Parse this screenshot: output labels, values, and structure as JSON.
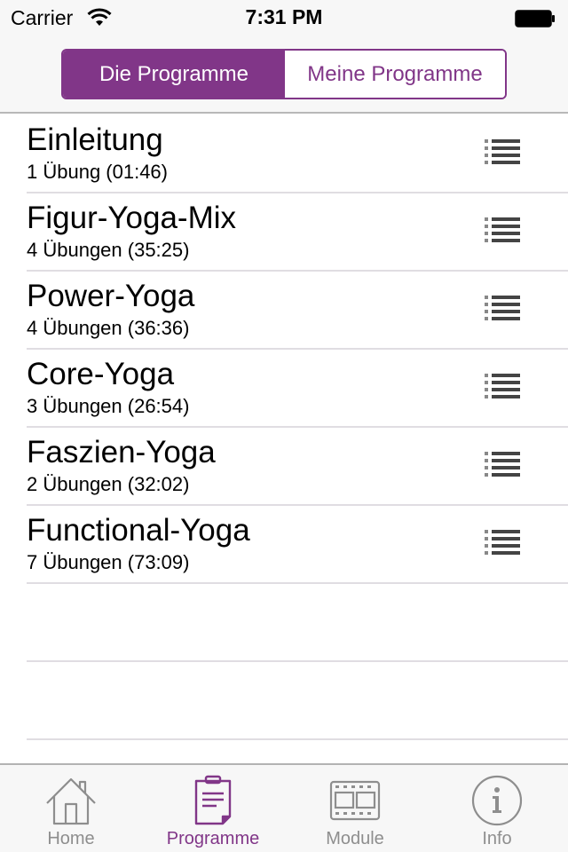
{
  "status_bar": {
    "carrier": "Carrier",
    "time": "7:31 PM",
    "wifi_icon": "wifi-icon",
    "battery_icon": "battery-full-icon"
  },
  "segmented_control": {
    "selected_index": 0,
    "segments": [
      {
        "label": "Die Programme"
      },
      {
        "label": "Meine Programme"
      }
    ]
  },
  "programs": [
    {
      "title": "Einleitung",
      "subtitle": "1 Übung (01:46)",
      "icon": "list-icon"
    },
    {
      "title": "Figur-Yoga-Mix",
      "subtitle": "4 Übungen (35:25)",
      "icon": "list-icon"
    },
    {
      "title": "Power-Yoga",
      "subtitle": "4 Übungen (36:36)",
      "icon": "list-icon"
    },
    {
      "title": "Core-Yoga",
      "subtitle": "3 Übungen (26:54)",
      "icon": "list-icon"
    },
    {
      "title": "Faszien-Yoga",
      "subtitle": "2 Übungen (32:02)",
      "icon": "list-icon"
    },
    {
      "title": "Functional-Yoga",
      "subtitle": "7 Übungen (73:09)",
      "icon": "list-icon"
    }
  ],
  "tab_bar": {
    "selected_index": 1,
    "tabs": [
      {
        "label": "Home",
        "icon": "house-icon"
      },
      {
        "label": "Programme",
        "icon": "clipboard-icon"
      },
      {
        "label": "Module",
        "icon": "film-strip-icon"
      },
      {
        "label": "Info",
        "icon": "info-icon"
      }
    ]
  },
  "colors": {
    "accent": "#813688",
    "tab_inactive": "#8e8e8e",
    "list_icon": "#444444",
    "separator": "#e0dde2"
  }
}
